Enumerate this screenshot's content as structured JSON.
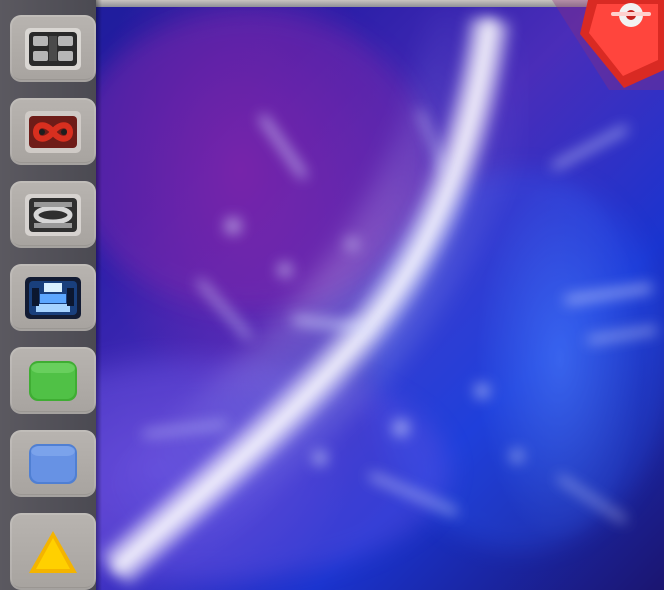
{
  "desktop": {
    "wallpaper": "cosmic-flare",
    "colors": {
      "background": "#14137f",
      "flare": "#ffffff",
      "violet": "#8b2bb5",
      "accent_blue": "#5a8cff",
      "dock_bg": "#4f4d55",
      "dock_tile": "#b4b0ad"
    }
  },
  "dock": {
    "items": [
      {
        "icon": "apps-grid-icon",
        "color": "#2a2a2a"
      },
      {
        "icon": "red-infinity-icon",
        "color": "#c92c1c"
      },
      {
        "icon": "network-ring-icon",
        "color": "#333333"
      },
      {
        "icon": "dark-blue-tools-icon",
        "color": "#193f7c"
      },
      {
        "icon": "green-square-icon",
        "color": "#3fad33"
      },
      {
        "icon": "blue-square-icon",
        "color": "#4f7fd3"
      },
      {
        "icon": "yellow-triangle-icon",
        "color": "#f4b400"
      }
    ]
  },
  "corner_badge": {
    "icon": "red-diamond-logo-icon",
    "color": "#e3302a"
  }
}
